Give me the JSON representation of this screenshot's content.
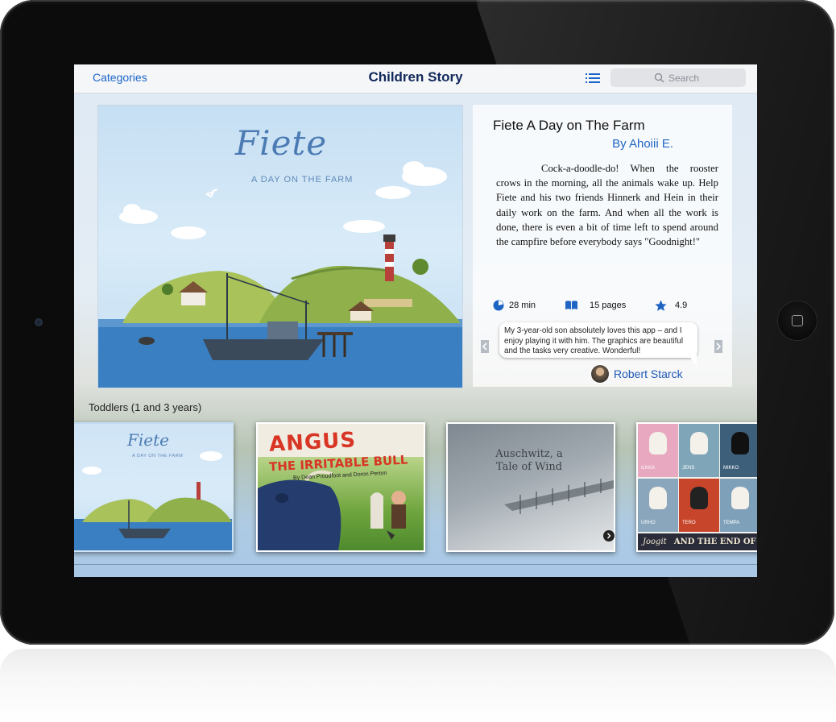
{
  "navbar": {
    "categories_label": "Categories",
    "title": "Children Story",
    "search_placeholder": "Search"
  },
  "cover": {
    "title": "Fiete",
    "subtitle": "A DAY ON THE FARM"
  },
  "detail": {
    "title": "Fiete A Day on The Farm",
    "author": "By Ahoiii E.",
    "description": "Cock-a-doodle-do! When the rooster crows in the morning, all the animals wake up. Help Fiete and his two friends Hinnerk and Hein in their daily work on the farm. And when all the work is done, there is even a bit of time left to spend around the campfire before everybody says \"Goodnight!\"",
    "duration": "28 min",
    "pages": "15 pages",
    "rating": "4.9",
    "review_text": "My 3-year-old son absolutely loves this app – and I enjoy playing it with him. The graphics are beautiful and the tasks very creative. Wonderful!",
    "reviewer": "Robert Starck"
  },
  "shelf": {
    "label": "Toddlers (1 and 3 years)",
    "books": [
      {
        "title": "Fiete",
        "subtitle": "A DAY ON THE FARM"
      },
      {
        "title": "ANGUS",
        "subtitle": "THE IRRITABLE BULL",
        "authors": "By Dean Proudfoot and Doron Perton"
      },
      {
        "title": "Auschwitz, a Tale of Wind"
      },
      {
        "brand": "Joogit",
        "tagline": "AND THE END OF W",
        "tiles": [
          "ILKKA",
          "JENS",
          "MIKKO",
          "URHO",
          "TERO",
          "TEMPA"
        ]
      }
    ]
  },
  "colors": {
    "accent": "#1b66c9",
    "title": "#10285a",
    "star": "#1e64c3"
  }
}
